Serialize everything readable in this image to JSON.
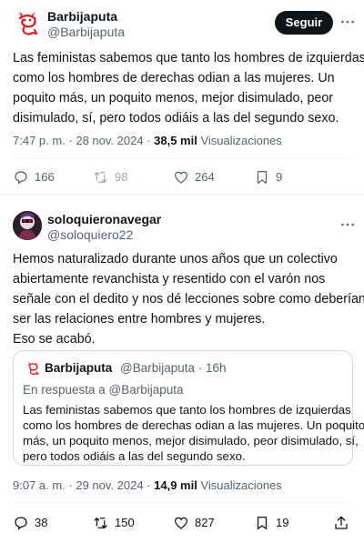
{
  "tweet1": {
    "author_name": "Barbijaputa",
    "author_handle": "@Barbijaputa",
    "follow_label": "Seguir",
    "text_lines": [
      "Las feministas sabemos que tanto los hombres de izquierdas",
      "como los hombres de derechas odian a las mujeres. Un",
      "poquito más, un poquito menos, mejor disimulado, peor",
      "disimulado, sí, pero todos odiáis a las del segundo sexo."
    ],
    "time": "7:47 p. m. · 28 nov. 2024 · ",
    "views_count": "38,5 mil",
    "views_label": " Visualizaciones",
    "replies": "166",
    "retweets": "98",
    "likes": "264",
    "bookmarks": "9"
  },
  "tweet2": {
    "author_name": "soloquieronavegar",
    "author_handle": "@soloquiero22",
    "text_lines": [
      "Hemos naturalizado durante unos años que un colectivo",
      "abiertamente revanchista y resentido con el varón nos",
      "señale con el dedito y nos dé lecciones sobre como deberían",
      "ser las relaciones entre hombres y mujeres.",
      "Eso se acabó."
    ],
    "quote": {
      "author_name": "Barbijaputa",
      "author_handle_time": "@Barbijaputa · 16h",
      "reply_to": "En respuesta a @Barbijaputa",
      "text_lines": [
        "Las feministas sabemos que tanto los hombres de izquierdas",
        "como los hombres de derechas odian a las mujeres. Un poquito",
        "más, un poquito menos, mejor disimulado, peor disimulado, sí,",
        "pero todos odiáis a las del segundo sexo."
      ]
    },
    "time": "9:07 a. m. · 29 nov. 2024 · ",
    "views_count": "14,9 mil",
    "views_label": " Visualizaciones",
    "replies": "38",
    "retweets": "150",
    "likes": "827",
    "bookmarks": "19"
  },
  "colors": {
    "text": "#0f1419",
    "secondary": "#536471",
    "border": "#cfd9de",
    "divider": "#eff3f4",
    "logo_red": "#d6252b"
  },
  "icons": [
    "devil-logo-icon",
    "more-icon",
    "reply-icon",
    "retweet-icon",
    "like-icon",
    "bookmark-icon",
    "share-icon"
  ]
}
